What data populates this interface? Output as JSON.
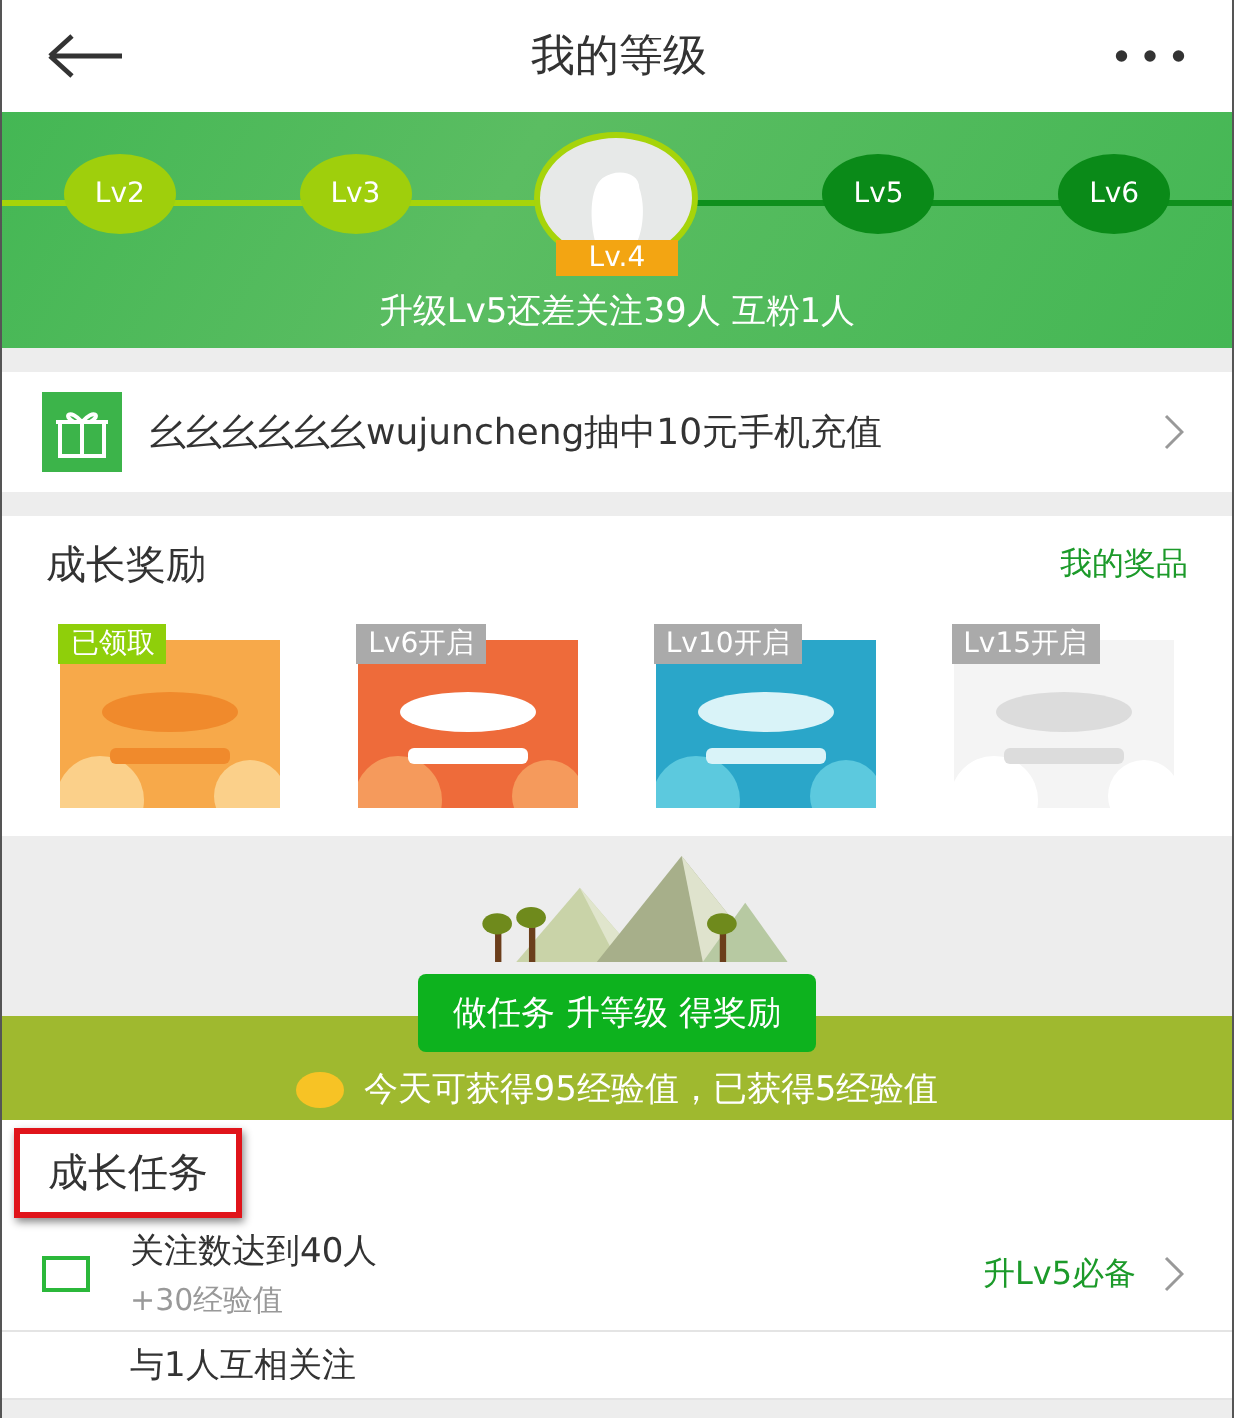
{
  "header": {
    "title": "我的等级"
  },
  "levels": [
    {
      "label": "Lv2",
      "kind": "passed"
    },
    {
      "label": "Lv3",
      "kind": "passed"
    },
    {
      "label": "Lv.4",
      "kind": "current"
    },
    {
      "label": "Lv5",
      "kind": "future"
    },
    {
      "label": "Lv6",
      "kind": "future"
    }
  ],
  "upgrade_hint": "升级Lv5还差关注39人 互粉1人",
  "notice": {
    "text": "幺幺幺幺幺幺wujuncheng抽中10元手机充值"
  },
  "rewards": {
    "title": "成长奖励",
    "link": "我的奖品",
    "items": [
      {
        "tag": "已领取",
        "received": true,
        "kind": "picture"
      },
      {
        "tag": "Lv6开启",
        "received": false,
        "kind": "picture"
      },
      {
        "tag": "Lv10开启",
        "received": false,
        "kind": "picture"
      },
      {
        "tag": "Lv15开启",
        "received": false,
        "kind": "picture"
      }
    ]
  },
  "banner": {
    "ribbon": "做任务 升等级 得奖励",
    "summary": "今天可获得95经验值，已获得5经验值"
  },
  "tasks": {
    "title": "成长任务",
    "highlighted": true,
    "items": [
      {
        "name": "关注数达到40人",
        "reward": "+30经验值",
        "badge": "升Lv5必备",
        "checked": false
      },
      {
        "name": "与1人互相关注"
      }
    ]
  }
}
